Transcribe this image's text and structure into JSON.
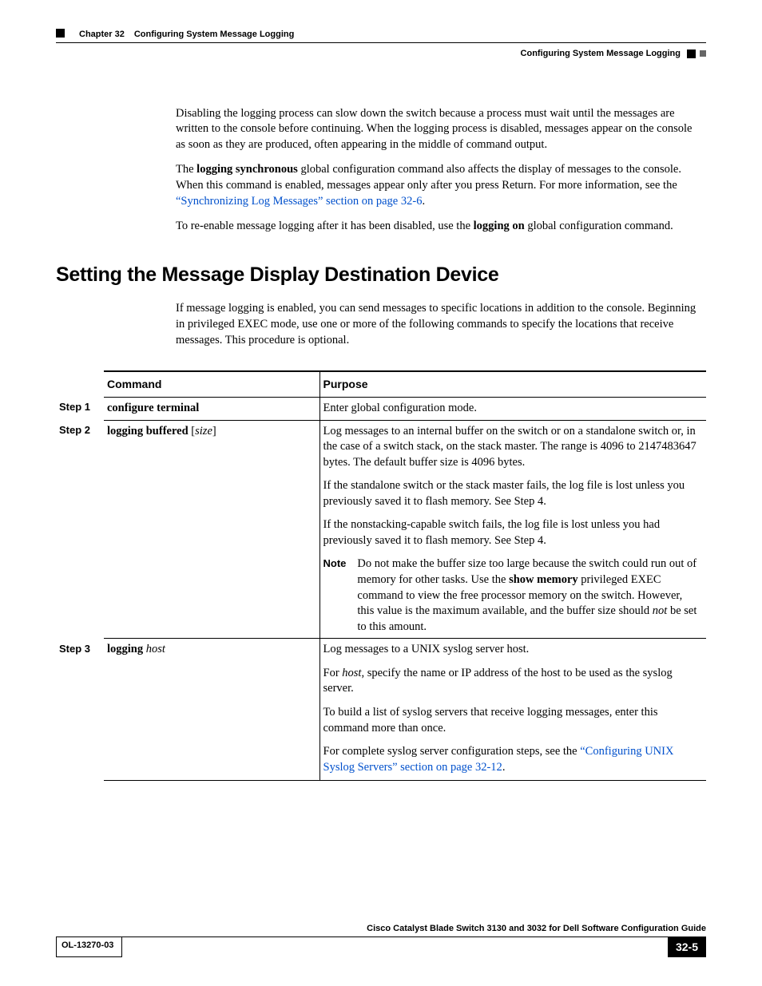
{
  "header": {
    "chapter_num": "Chapter 32",
    "chapter_title": "Configuring System Message Logging",
    "section": "Configuring System Message Logging"
  },
  "intro": {
    "p1": "Disabling the logging process can slow down the switch because a process must wait until the messages are written to the console before continuing. When the logging process is disabled, messages appear on the console as soon as they are produced, often appearing in the middle of command output.",
    "p2_a": "The ",
    "p2_bold": "logging synchronous",
    "p2_b": " global configuration command also affects the display of messages to the console. When this command is enabled, messages appear only after you press Return. For more information, see the ",
    "p2_link": "“Synchronizing Log Messages” section on page 32-6",
    "p2_c": ".",
    "p3_a": "To re-enable message logging after it has been disabled, use the ",
    "p3_bold": "logging on",
    "p3_b": " global configuration command."
  },
  "section_title": "Setting the Message Display Destination Device",
  "section_intro": "If message logging is enabled, you can send messages to specific locations in addition to the console. Beginning in privileged EXEC mode, use one or more of the following commands to specify the locations that receive messages. This procedure is optional.",
  "table": {
    "col_command": "Command",
    "col_purpose": "Purpose",
    "rows": [
      {
        "step": "Step 1",
        "cmd": "configure terminal",
        "purpose": [
          {
            "t": "plain",
            "text": "Enter global configuration mode."
          }
        ]
      },
      {
        "step": "Step 2",
        "cmd_a": "logging buffered ",
        "cmd_b": "[",
        "cmd_i": "size",
        "cmd_c": "]",
        "purpose": {
          "p1": "Log messages to an internal buffer on the switch or on a standalone switch or, in the case of a switch stack, on the stack master. The range is 4096 to 2147483647 bytes. The default buffer size is 4096 bytes.",
          "p2": "If the standalone switch or the stack master fails, the log file is lost unless you previously saved it to flash memory. See Step 4.",
          "p3": "If the nonstacking-capable switch fails, the log file is lost unless you had previously saved it to flash memory. See Step 4.",
          "note_label": "Note",
          "note_a": "Do not make the buffer size too large because the switch could run out of memory for other tasks. Use the ",
          "note_bold": "show memory",
          "note_b": " privileged EXEC command to view the free processor memory on the switch. However, this value is the maximum available, and the buffer size should ",
          "note_i": "not",
          "note_c": " be set to this amount."
        }
      },
      {
        "step": "Step 3",
        "cmd_a": "logging ",
        "cmd_i": "host",
        "purpose": {
          "p1": "Log messages to a UNIX syslog server host.",
          "p2_a": "For ",
          "p2_i": "host",
          "p2_b": ", specify the name or IP address of the host to be used as the syslog server.",
          "p3": "To build a list of syslog servers that receive logging messages, enter this command more than once.",
          "p4_a": "For complete syslog server configuration steps, see the ",
          "p4_link": "“Configuring UNIX Syslog Servers” section on page 32-12",
          "p4_b": "."
        }
      }
    ]
  },
  "footer": {
    "guide": "Cisco Catalyst Blade Switch 3130 and 3032 for Dell Software Configuration Guide",
    "ol": "OL-13270-03",
    "page": "32-5"
  }
}
